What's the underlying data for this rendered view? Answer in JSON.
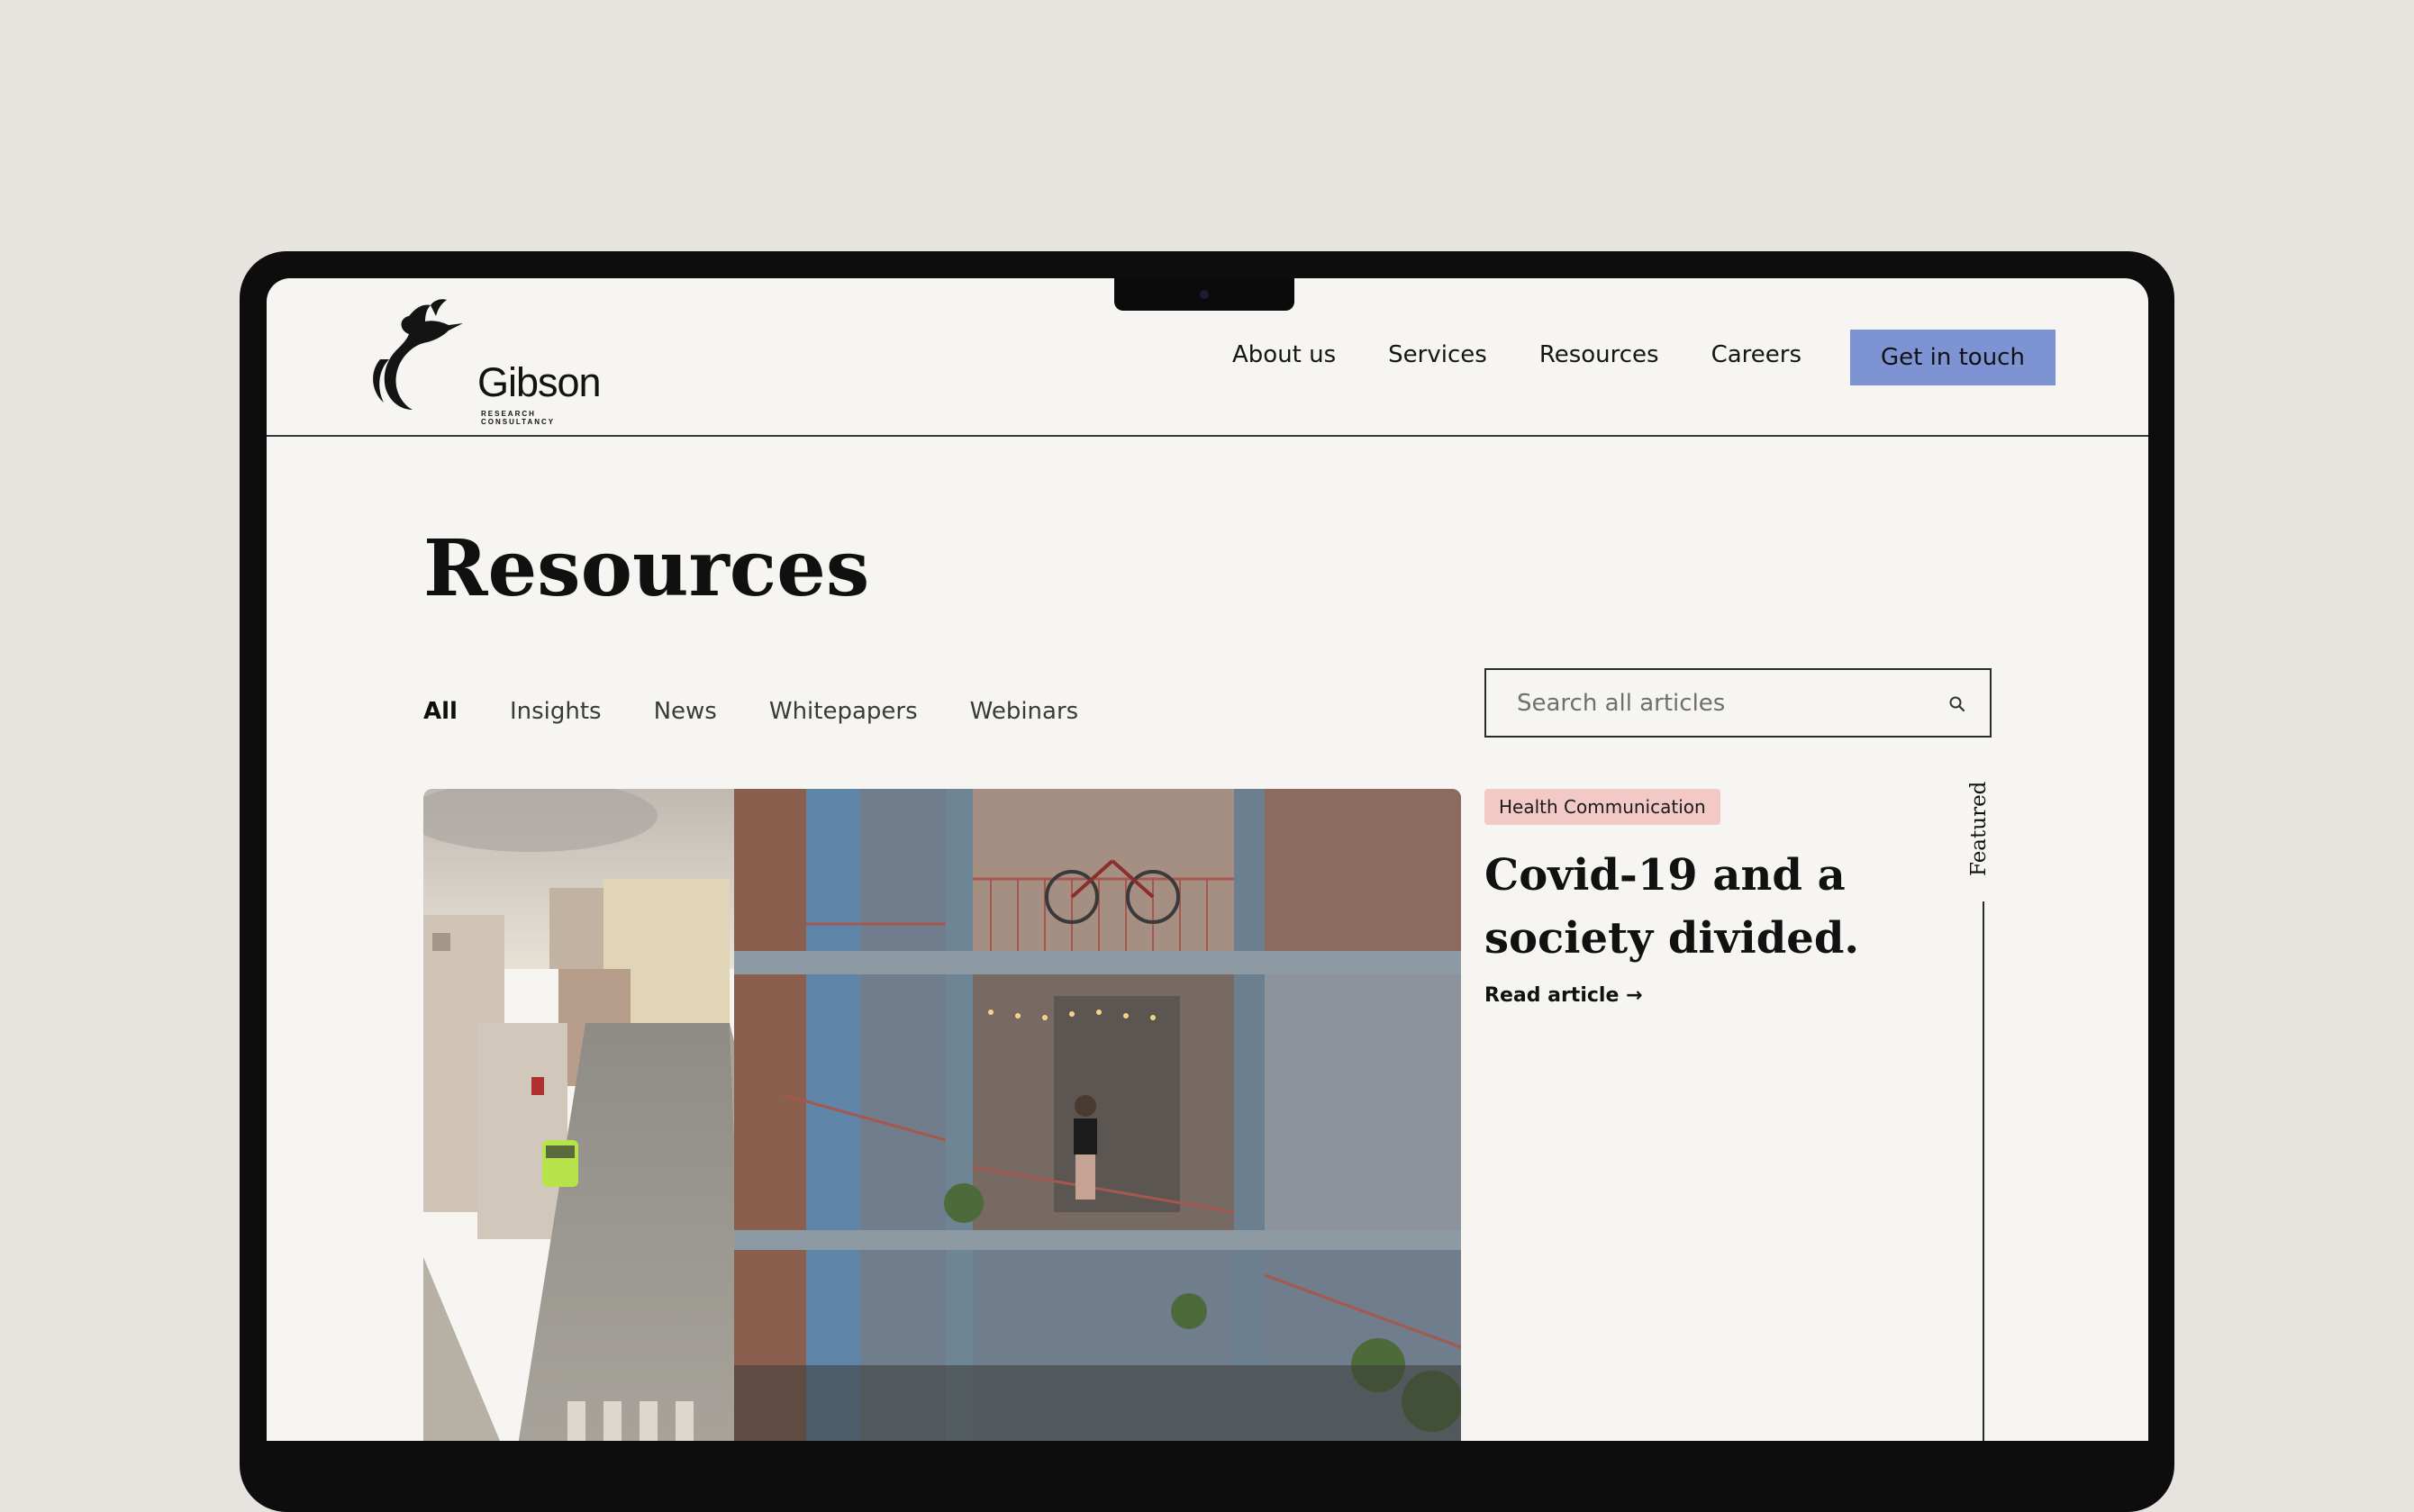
{
  "brand": {
    "name": "Gibson",
    "tagline": "RESEARCH CONSULTANCY"
  },
  "nav": {
    "items": [
      {
        "label": "About us"
      },
      {
        "label": "Services"
      },
      {
        "label": "Resources"
      },
      {
        "label": "Careers"
      }
    ],
    "cta_label": "Get in touch"
  },
  "page": {
    "title": "Resources"
  },
  "filters": [
    {
      "label": "All",
      "active": true
    },
    {
      "label": "Insights",
      "active": false
    },
    {
      "label": "News",
      "active": false
    },
    {
      "label": "Whitepapers",
      "active": false
    },
    {
      "label": "Webinars",
      "active": false
    }
  ],
  "search": {
    "placeholder": "Search all articles",
    "icon": "search-icon"
  },
  "featured_article": {
    "tag": "Health Communication",
    "title_line1": "Covid-19 and a",
    "title_line2": "society divided.",
    "link_label": "Read article →",
    "side_label": "Featured"
  },
  "colors": {
    "background": "#e7e3de",
    "screen": "#f6f5f2",
    "cta": "#7e93d3",
    "tag": "#f2c9c4"
  }
}
